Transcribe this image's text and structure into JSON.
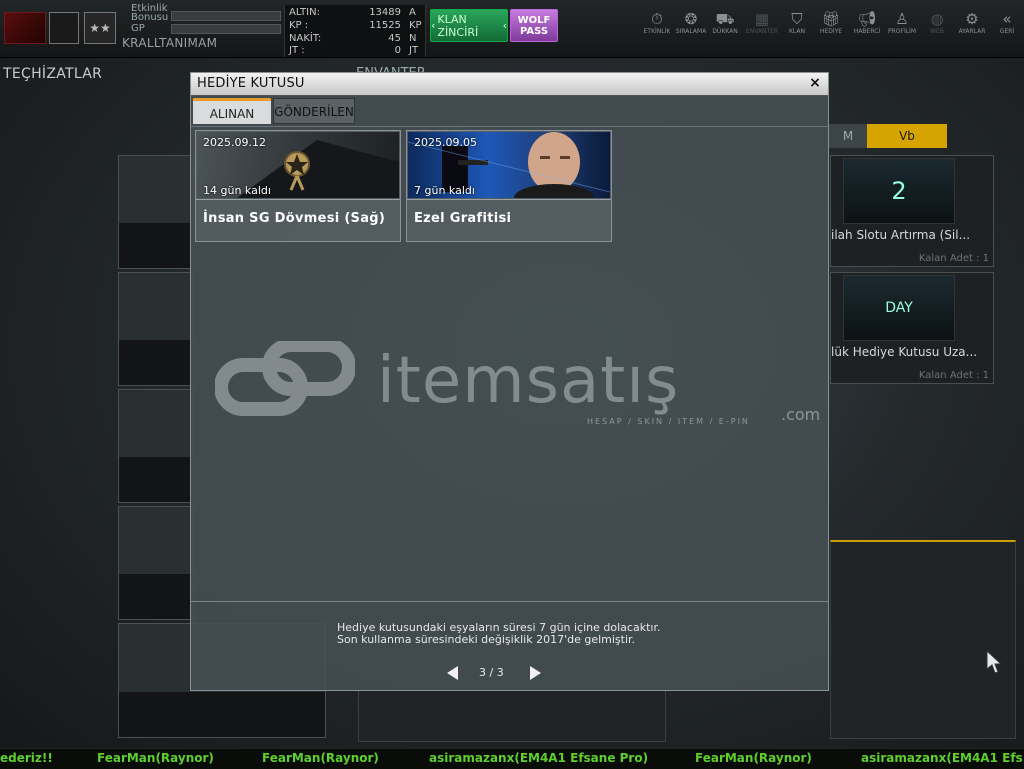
{
  "topbar": {
    "logo_text": "",
    "rank_text": "",
    "stars": "★★",
    "labels": {
      "etkinlik": "Etkinlik",
      "bonusu": "Bonusu",
      "gp": "GP"
    },
    "nickname": "KRALLTANIMAM",
    "currencies": [
      {
        "name": "ALTIN:",
        "value": "13489",
        "unit": "A"
      },
      {
        "name": "KP :",
        "value": "11525",
        "unit": "KP"
      },
      {
        "name": "NAKİT:",
        "value": "45",
        "unit": "N"
      },
      {
        "name": "JT :",
        "value": "0",
        "unit": "JT"
      }
    ],
    "klan_button": "KLAN ZİNCİRİ",
    "wolf_button_line1": "WOLF",
    "wolf_button_line2": "PASS",
    "nav": [
      {
        "label": "ETKİNLİK",
        "icon": "stopwatch-icon"
      },
      {
        "label": "SIRALAMA",
        "icon": "medal-icon"
      },
      {
        "label": "DÜKKAN",
        "icon": "cart-icon"
      },
      {
        "label": "ENVANTER",
        "icon": "inventory-icon"
      },
      {
        "label": "KLAN",
        "icon": "shield-icon"
      },
      {
        "label": "HEDİYE",
        "icon": "gift-icon"
      },
      {
        "label": "HABERCİ",
        "icon": "megaphone-icon"
      },
      {
        "label": "PROFİLİM",
        "icon": "profile-icon"
      },
      {
        "label": "WEB",
        "icon": "globe-icon"
      },
      {
        "label": "AYARLAR",
        "icon": "gear-icon"
      },
      {
        "label": "GERİ",
        "icon": "back-icon"
      }
    ]
  },
  "left_section_title": "TEÇHİZATLAR",
  "center_section_title": "ENVANTER",
  "right_panel": {
    "tab_left": "M",
    "tab_active": "Vb",
    "cards": [
      {
        "name": "ilah Slotu Artırma (Sil...",
        "qty": "Kalan Adet : 1",
        "badge": "2"
      },
      {
        "name": "lük Hediye Kutusu Uza...",
        "qty": "Kalan Adet : 1",
        "badge": "DAY"
      }
    ]
  },
  "modal": {
    "title": "HEDİYE KUTUSU",
    "close_glyph": "×",
    "tabs": {
      "received": "ALINAN",
      "sent": "GÖNDERİLEN"
    },
    "gifts": [
      {
        "date": "2025.09.12",
        "days_left": "14 gün kaldı",
        "name": "İnsan SG Dövmesi (Sağ)"
      },
      {
        "date": "2025.09.05",
        "days_left": "7 gün kaldı",
        "name": "Ezel Grafitisi"
      }
    ],
    "watermark": {
      "brand": "itemsatış",
      "tagline": "HESAP / SKIN / ITEM / E-PIN",
      "domain": ".com"
    },
    "notice_line1": "Hediye kutusundaki eşyaların süresi 7 gün içine dolacaktır.",
    "notice_line2": "Son kullanma süresindeki değişiklik 2017'de gelmiştir.",
    "pager": "3 / 3"
  },
  "ticker": [
    "ederiz!!",
    "FearMan(Raynor)",
    "FearMan(Raynor)",
    "asiramazanx(EM4A1 Efsane Pro)",
    "FearMan(Raynor)",
    "asiramazanx(EM4A1 Efs"
  ],
  "colors": {
    "accent_orange": "#e79a25",
    "ticker_green": "#5dcf2e",
    "klan_green": "#1f8a48",
    "wolf_purple": "#a85dc8",
    "tab_yellow": "#d6a400"
  }
}
